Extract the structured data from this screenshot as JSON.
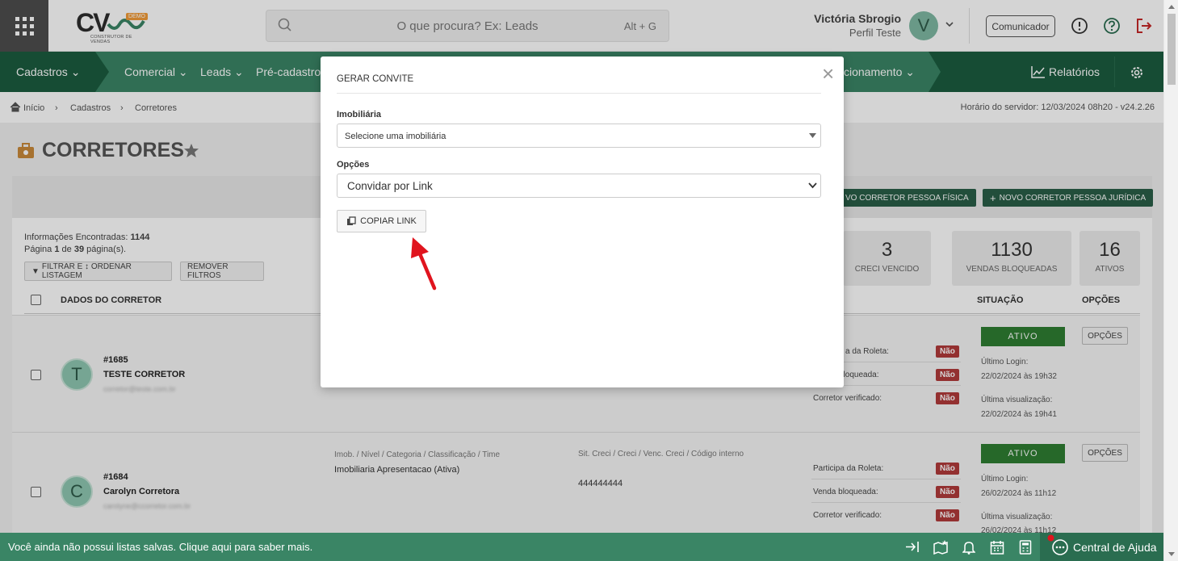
{
  "topbar": {
    "logo": {
      "letters": "CV",
      "badge": "DEMO",
      "subtitle": "CONSTRUTOR DE VENDAS"
    },
    "search": {
      "placeholder": "O que procura? Ex: Leads",
      "shortcut": "Alt + G"
    },
    "user": {
      "name": "Victória Sbrogio",
      "profile": "Perfil Teste",
      "initial": "V"
    },
    "communicator_label": "Comunicador"
  },
  "nav": {
    "items": [
      "Cadastros",
      "Comercial",
      "Leads",
      "Pré-cadastros",
      "cionamento"
    ],
    "reports": "Relatórios"
  },
  "breadcrumb": {
    "items": [
      "Início",
      "Cadastros",
      "Corretores"
    ],
    "server_time": "Horário do servidor: 12/03/2024 08h20 - v24.2.26"
  },
  "page": {
    "title": "CORRETORES",
    "buttons": {
      "new_pf": "VO CORRETOR PESSOA FÍSICA",
      "new_pj": "NOVO CORRETOR PESSOA JURÍDICA"
    },
    "info": {
      "found_label": "Informações Encontradas:",
      "found_value": "1144",
      "page_prefix": "Página",
      "page_current": "1",
      "page_mid": "de",
      "page_total": "39",
      "page_suffix": "página(s)."
    },
    "filter_button": "FILTRAR E ↕ ORDENAR LISTAGEM",
    "remove_filters": "REMOVER FILTROS",
    "stats": [
      {
        "value": "3",
        "label": "CRECI VENCIDO"
      },
      {
        "value": "1130",
        "label": "VENDAS BLOQUEADAS"
      },
      {
        "value": "16",
        "label": "ATIVOS"
      }
    ],
    "columns": {
      "data": "DADOS DO CORRETOR",
      "status": "SITUAÇÃO",
      "options": "OPÇÕES"
    }
  },
  "rows": [
    {
      "id": "#1685",
      "name": "TESTE CORRETOR",
      "initial": "T",
      "email": "corretor@teste.com.br",
      "flags": [
        "a da Roleta:",
        "bloqueada:",
        "Corretor verificado:"
      ],
      "flag_value": "Não",
      "status": "ATIVO",
      "last_login_label": "Último Login:",
      "last_login": "22/02/2024 às 19h32",
      "last_view_label": "Última visualização:",
      "last_view": "22/02/2024 às 19h41",
      "options": "OPÇÕES"
    },
    {
      "id": "#1684",
      "name": "Carolyn Corretora",
      "initial": "C",
      "email": "carolyne@ccorretor.com.br",
      "imob_header": "Imob. / Nível / Categoria / Classificação / Time",
      "imob_value": "Imobiliaria Apresentacao (Ativa)",
      "creci_header": "Sit. Creci / Creci / Venc. Creci / Código interno",
      "creci_value": "444444444",
      "flags": [
        "Participa da Roleta:",
        "Venda bloqueada:",
        "Corretor verificado:"
      ],
      "flag_value": "Não",
      "status": "ATIVO",
      "last_login_label": "Último Login:",
      "last_login": "26/02/2024 às 11h12",
      "last_view_label": "Última visualização:",
      "last_view": "26/02/2024 às 11h12",
      "options": "OPÇÕES"
    }
  ],
  "bottom": {
    "message": "Você ainda não possui listas salvas. Clique aqui para saber mais.",
    "help": "Central de Ajuda"
  },
  "modal": {
    "title": "GERAR CONVITE",
    "imobiliaria_label": "Imobiliária",
    "imobiliaria_value": "Selecione uma imobiliária",
    "options_label": "Opções",
    "options_value": "Convidar por Link",
    "copy_button": "COPIAR LINK"
  },
  "colors": {
    "nav": "#3a8565",
    "nav_dark": "#1b5c3f",
    "danger": "#b13a3a",
    "success": "#2e7d32",
    "arrow": "#e0141e"
  }
}
